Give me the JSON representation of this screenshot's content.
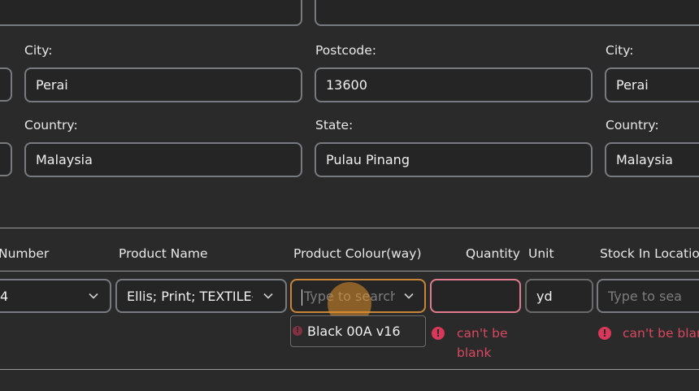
{
  "address_left": {
    "city_label": "City:",
    "city_value": "Perai",
    "country_label": "Country:",
    "country_value": "Malaysia"
  },
  "address_mid": {
    "postcode_label": "Postcode:",
    "postcode_value": "13600",
    "state_label": "State:",
    "state_value": "Pulau Pinang"
  },
  "address_right": {
    "city_label": "City:",
    "city_value": "Perai",
    "country_label": "Country:",
    "country_value": "Malaysia"
  },
  "table": {
    "headers": {
      "number": "Number",
      "product_name": "Product Name",
      "colour": "Product Colour(way)",
      "quantity": "Quantity",
      "unit": "Unit",
      "stock_location": "Stock In Location"
    },
    "row": {
      "number_value": "4",
      "product_name_value": "Ellis; Print; TEXTILE-W",
      "colour_placeholder": "Type to search...",
      "quantity_value": "",
      "unit_value": "yd",
      "stock_placeholder": "Type to sea"
    },
    "dropdown_option": "Black 00A v16",
    "errors": {
      "quantity": "can't be blank",
      "stock": "can't be blank"
    }
  },
  "colors": {
    "background": "#2a2a2a",
    "error": "#d9485f",
    "focus_border": "#c8853a",
    "cursor_highlight": "#e0902c"
  },
  "icons": [
    "chevron-down-icon",
    "error-icon"
  ]
}
